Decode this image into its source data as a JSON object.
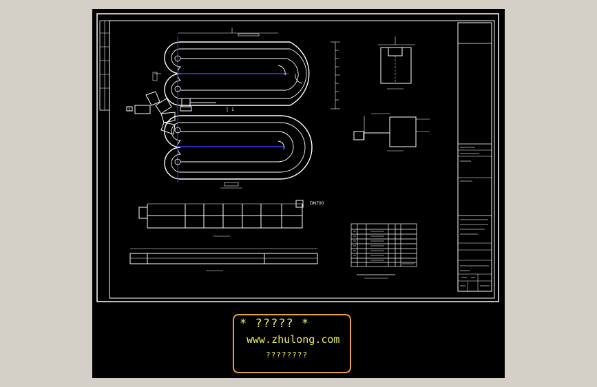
{
  "watermark": {
    "line1": "* ????? *",
    "line2": "www.zhulong.com",
    "line3": "????????"
  },
  "drawing": {
    "dimension_label": "DN700",
    "section_marks": [
      "1",
      "1"
    ]
  },
  "colors": {
    "background": "#000000",
    "lines": "#ffffff",
    "channel_axis": "#3a3aff",
    "watermark_text": "#f0f060",
    "watermark_border": "#e8a03c",
    "window": "#d4d0c8"
  }
}
